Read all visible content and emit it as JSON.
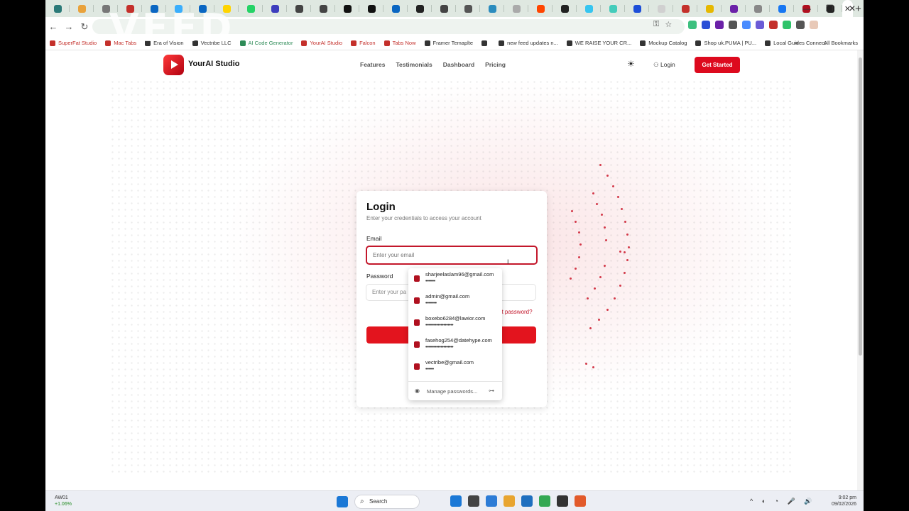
{
  "browser": {
    "tab_favicons": [
      "#2b7a78",
      "#e9a23b",
      "#777",
      "#c4302b",
      "#0a66c2",
      "#3aaefc",
      "#0a66c2",
      "#ffd400",
      "#25d366",
      "#3d3dbd",
      "#444",
      "#444",
      "#111",
      "#111",
      "#0a66c2",
      "#222",
      "#444",
      "#555",
      "#2b8cbe",
      "#aaa",
      "#ff4500",
      "#222",
      "#36c5f0",
      "#4cb",
      "#1d4ed8",
      "#d0d0d0",
      "#c4302b",
      "#e6b800",
      "#6b21a8",
      "#888",
      "#1877f2",
      "#b0101f",
      "#222"
    ],
    "active_tab_close": "✕",
    "new_tab": "+",
    "window_controls": [
      "—",
      "❐",
      "✕"
    ],
    "nav": {
      "back": "←",
      "forward": "→",
      "reload": "↻"
    },
    "omnibox_icons": [
      "⚿",
      "☆"
    ],
    "extensions": [
      "#3ec07f",
      "#2b4fd6",
      "#6b21a8",
      "#555",
      "#4a8cff",
      "#6b5bd6",
      "#c4302b",
      "#2fc36a",
      "#555",
      "#e8c9b8"
    ]
  },
  "bookmarks": {
    "items": [
      {
        "label": "SuperFat Studio",
        "color": "#c4302b"
      },
      {
        "label": "Mac Tabs",
        "color": "#c4302b"
      },
      {
        "label": "Era of Vision",
        "color": "#333"
      },
      {
        "label": "Vectribe LLC",
        "color": "#333"
      },
      {
        "label": "AI Code Generator",
        "color": "#2e8b57"
      },
      {
        "label": "YourAI Studio",
        "color": "#c4302b"
      },
      {
        "label": "Falcon",
        "color": "#c4302b"
      },
      {
        "label": "Tabs Now",
        "color": "#c4302b"
      },
      {
        "label": "Framer Temaplte",
        "color": "#333"
      },
      {
        "label": "",
        "color": "#333"
      },
      {
        "label": "new feed updates n...",
        "color": "#333"
      },
      {
        "label": "WE RAISE YOUR CR...",
        "color": "#333"
      },
      {
        "label": "Mockup Catalog",
        "color": "#333"
      },
      {
        "label": "Shop uk.PUMA | PU...",
        "color": "#333"
      },
      {
        "label": "Local Guides Connect",
        "color": "#333"
      }
    ],
    "more": "»",
    "all_label": "All Bookmarks"
  },
  "site": {
    "brand": "YourAI Studio",
    "nav": [
      "Features",
      "Testimonials",
      "Dashboard",
      "Pricing"
    ],
    "theme_icon": "☀",
    "login": "Login",
    "get_started": "Get Started"
  },
  "login": {
    "title": "Login",
    "subtitle": "Enter your credentials to access your account",
    "email_label": "Email",
    "email_placeholder": "Enter your email",
    "password_label": "Password",
    "password_placeholder": "Enter your pa",
    "forgot": "ot password?",
    "submit": ""
  },
  "autofill": {
    "items": [
      {
        "email": "sharjeelaslam96@gmail.com",
        "dots": "•••••••"
      },
      {
        "email": "admin@gmail.com",
        "dots": "••••••••"
      },
      {
        "email": "boxebo6284@lawior.com",
        "dots": "••••••••••••••••••••"
      },
      {
        "email": "fasehog254@datehype.com",
        "dots": "••••••••••••••••••••"
      },
      {
        "email": "vectribe@gmail.com",
        "dots": "••••••"
      }
    ],
    "manage": "Manage passwords...",
    "manage_icon": "◉",
    "key_icon": "⊶"
  },
  "taskbar": {
    "weather_title": "AW01",
    "weather_change": "+1.06%",
    "search": "Search",
    "icons": [
      "#1b78d6",
      "#444",
      "#2d7cd6",
      "#e8a530",
      "#1f6fbf",
      "#34a853",
      "#333",
      "#e25a2b"
    ],
    "tray": "^ ◐ ◔ 🎤 🔊",
    "time": "9:02 pm",
    "date": "09/02/2026"
  },
  "watermark": "VEED"
}
